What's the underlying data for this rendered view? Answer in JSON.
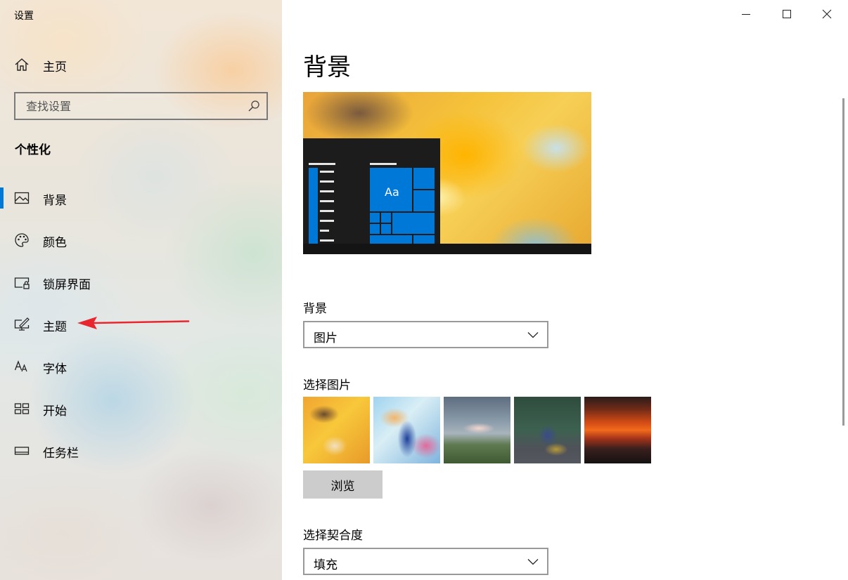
{
  "window": {
    "title": "设置"
  },
  "sidebar": {
    "home_label": "主页",
    "search_placeholder": "查找设置",
    "section_title": "个性化",
    "items": [
      {
        "label": "背景",
        "icon": "picture-icon",
        "selected": true
      },
      {
        "label": "颜色",
        "icon": "palette-icon",
        "selected": false
      },
      {
        "label": "锁屏界面",
        "icon": "lock-screen-icon",
        "selected": false
      },
      {
        "label": "主题",
        "icon": "theme-brush-icon",
        "selected": false
      },
      {
        "label": "字体",
        "icon": "font-icon",
        "selected": false
      },
      {
        "label": "开始",
        "icon": "start-grid-icon",
        "selected": false
      },
      {
        "label": "任务栏",
        "icon": "taskbar-icon",
        "selected": false
      }
    ]
  },
  "main": {
    "page_title": "背景",
    "preview": {
      "tile_label": "Aa"
    },
    "background_label": "背景",
    "background_value": "图片",
    "choose_picture_label": "选择图片",
    "thumbnails": [
      "thumbnail-yellow-art",
      "thumbnail-blue-art",
      "thumbnail-cloud-field",
      "thumbnail-stitch",
      "thumbnail-sunset"
    ],
    "browse_label": "浏览",
    "fit_label": "选择契合度",
    "fit_value": "填充"
  },
  "colors": {
    "accent": "#0078d7",
    "annotation_arrow": "#e8262e"
  }
}
